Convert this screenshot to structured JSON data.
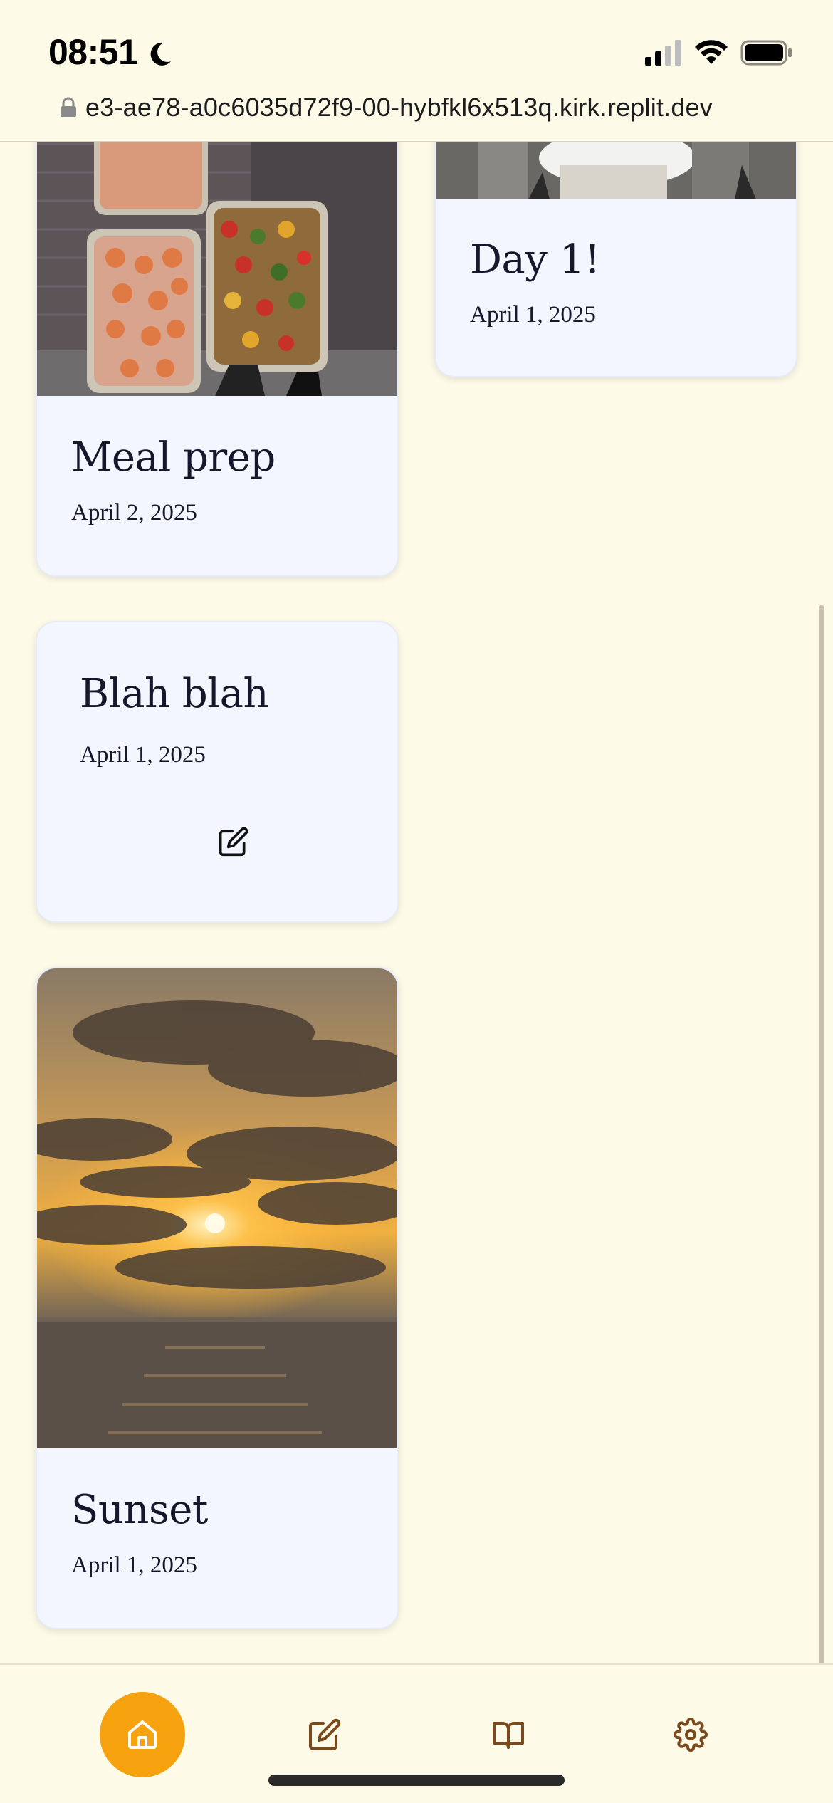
{
  "status_bar": {
    "time": "08:51",
    "moon_icon": "moon-icon",
    "signal_icon": "cellular-signal-icon",
    "wifi_icon": "wifi-icon",
    "battery_icon": "battery-icon"
  },
  "browser": {
    "url": "e3-ae78-a0c6035d72f9-00-hybfkl6x513q.kirk.replit.dev",
    "lock_icon": "lock-icon"
  },
  "entries": [
    {
      "title": "Meal prep",
      "date": "April 2, 2025",
      "has_photo": true,
      "photo": "meal prep containers of shrimp and vegetables"
    },
    {
      "title": "Day 1!",
      "date": "April 1, 2025",
      "has_photo": true,
      "photo": "outdoor scene with table"
    },
    {
      "title": "Blah blah",
      "date": "April 1, 2025",
      "has_photo": false,
      "icon": "edit-icon"
    },
    {
      "title": "Sunset",
      "date": "April 1, 2025",
      "has_photo": true,
      "photo": "sunset over the ocean"
    }
  ],
  "bottom_nav": {
    "items": [
      {
        "name": "home",
        "icon": "home-icon",
        "active": true
      },
      {
        "name": "write",
        "icon": "edit-icon",
        "active": false
      },
      {
        "name": "journal",
        "icon": "book-open-icon",
        "active": false
      },
      {
        "name": "settings",
        "icon": "gear-icon",
        "active": false
      }
    ]
  },
  "colors": {
    "background": "#fefae8",
    "card": "#f3f6ff",
    "accent": "#f6a10e",
    "nav_icon": "#7a4a1d",
    "text": "#15172b"
  }
}
